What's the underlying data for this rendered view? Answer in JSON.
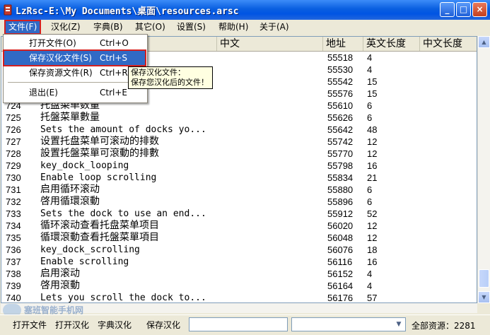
{
  "window": {
    "title": "LzRsc-E:\\My Documents\\桌面\\resources.arsc",
    "minimize_label": "_",
    "maximize_label": "□",
    "close_label": "×"
  },
  "menu": {
    "file": "文件(F)",
    "localize": "汉化(Z)",
    "dictionary": "字典(B)",
    "other": "其它(O)",
    "settings": "设置(S)",
    "help": "帮助(H)",
    "about": "关于(A)"
  },
  "file_menu": {
    "items": [
      {
        "label": "打开文件(O)",
        "shortcut": "Ctrl+O"
      },
      {
        "label": "保存汉化文件(S)",
        "shortcut": "Ctrl+S"
      },
      {
        "label": "保存资源文件(R)",
        "shortcut": "Ctrl+R"
      },
      {
        "label": "退出(E)",
        "shortcut": "Ctrl+E"
      }
    ]
  },
  "tooltip": {
    "line1": "保存汉化文件：",
    "line2": "保存您汉化后的文件！"
  },
  "table": {
    "columns": {
      "chinese": "中文",
      "address": "地址",
      "en_length": "英文长度",
      "cn_length": "中文长度"
    },
    "rows": [
      {
        "id": "",
        "text": "",
        "addr": "55518",
        "len": "4"
      },
      {
        "id": "",
        "text": "",
        "addr": "55530",
        "len": "4"
      },
      {
        "id": "",
        "text": "",
        "addr": "55542",
        "len": "15"
      },
      {
        "id": "",
        "text": "",
        "addr": "55576",
        "len": "15"
      },
      {
        "id": "724",
        "text": "托盘菜单数量",
        "addr": "55610",
        "len": "6"
      },
      {
        "id": "725",
        "text": "托盤菜單數量",
        "addr": "55626",
        "len": "6"
      },
      {
        "id": "726",
        "text": "Sets the amount of docks yo...",
        "addr": "55642",
        "len": "48"
      },
      {
        "id": "727",
        "text": "设置托盘菜单可滚动的排数",
        "addr": "55742",
        "len": "12"
      },
      {
        "id": "728",
        "text": "設置托盤菜單可滾動的排數",
        "addr": "55770",
        "len": "12"
      },
      {
        "id": "729",
        "text": "key_dock_looping",
        "addr": "55798",
        "len": "16"
      },
      {
        "id": "730",
        "text": "Enable loop scrolling",
        "addr": "55834",
        "len": "21"
      },
      {
        "id": "731",
        "text": "启用循环滚动",
        "addr": "55880",
        "len": "6"
      },
      {
        "id": "732",
        "text": "啓用循環滾動",
        "addr": "55896",
        "len": "6"
      },
      {
        "id": "733",
        "text": "Sets the dock to use an end...",
        "addr": "55912",
        "len": "52"
      },
      {
        "id": "734",
        "text": "循环滚动查看托盘菜单项目",
        "addr": "56020",
        "len": "12"
      },
      {
        "id": "735",
        "text": "循環滾動查看托盤菜單項目",
        "addr": "56048",
        "len": "12"
      },
      {
        "id": "736",
        "text": "key_dock_scrolling",
        "addr": "56076",
        "len": "18"
      },
      {
        "id": "737",
        "text": "Enable scrolling",
        "addr": "56116",
        "len": "16"
      },
      {
        "id": "738",
        "text": "启用滚动",
        "addr": "56152",
        "len": "4"
      },
      {
        "id": "739",
        "text": "啓用滾動",
        "addr": "56164",
        "len": "4"
      },
      {
        "id": "740",
        "text": "Lets you scroll the dock to...",
        "addr": "56176",
        "len": "57"
      }
    ]
  },
  "toolbar": {
    "open_file": "打开文件",
    "open_localize": "打开汉化",
    "dict_localize": "字典汉化",
    "save_localize": "保存汉化",
    "dropdown_arrow": "▼",
    "total_label": "全部资源：2281"
  },
  "watermark": {
    "text": "塞班智能手机网"
  }
}
